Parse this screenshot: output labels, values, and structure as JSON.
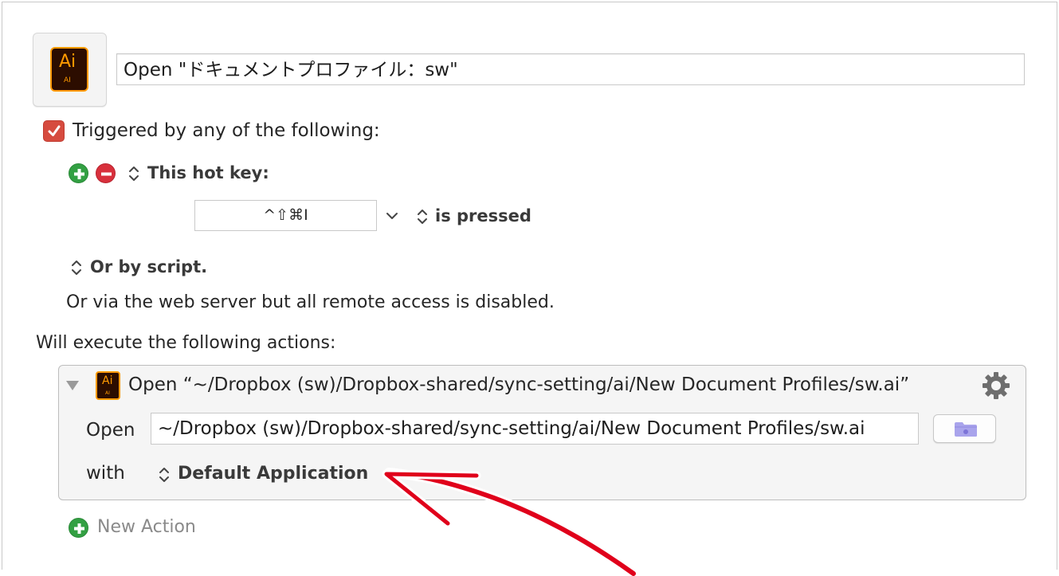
{
  "macro": {
    "icon": "adobe-illustrator-icon",
    "icon_text": "Ai",
    "icon_subtext": "AI",
    "name": "Open \"ドキュメントプロファイル：sw\""
  },
  "triggers": {
    "enabled": true,
    "heading": "Triggered by any of the following:",
    "hotkey_label": "This hot key:",
    "hotkey_value": "^⇧⌘I",
    "hotkey_state": "is pressed",
    "script_label": "Or by script.",
    "web_server_note": "Or via the web server but all remote access is disabled."
  },
  "actions": {
    "heading": "Will execute the following actions:",
    "items": [
      {
        "title": "Open “~/Dropbox (sw)/Dropbox-shared/sync-setting/ai/New Document Profiles/sw.ai”",
        "open_label": "Open",
        "path": "~/Dropbox (sw)/Dropbox-shared/sync-setting/ai/New Document Profiles/sw.ai",
        "with_label": "with",
        "application": "Default Application"
      }
    ],
    "new_action_label": "New Action"
  },
  "colors": {
    "checkbox": "#d64b3f",
    "add": "#33a043",
    "remove": "#d8303c",
    "annotation_arrow": "#e0001b",
    "ai_orange": "#ff9a00",
    "ai_background": "#2c0d00"
  }
}
